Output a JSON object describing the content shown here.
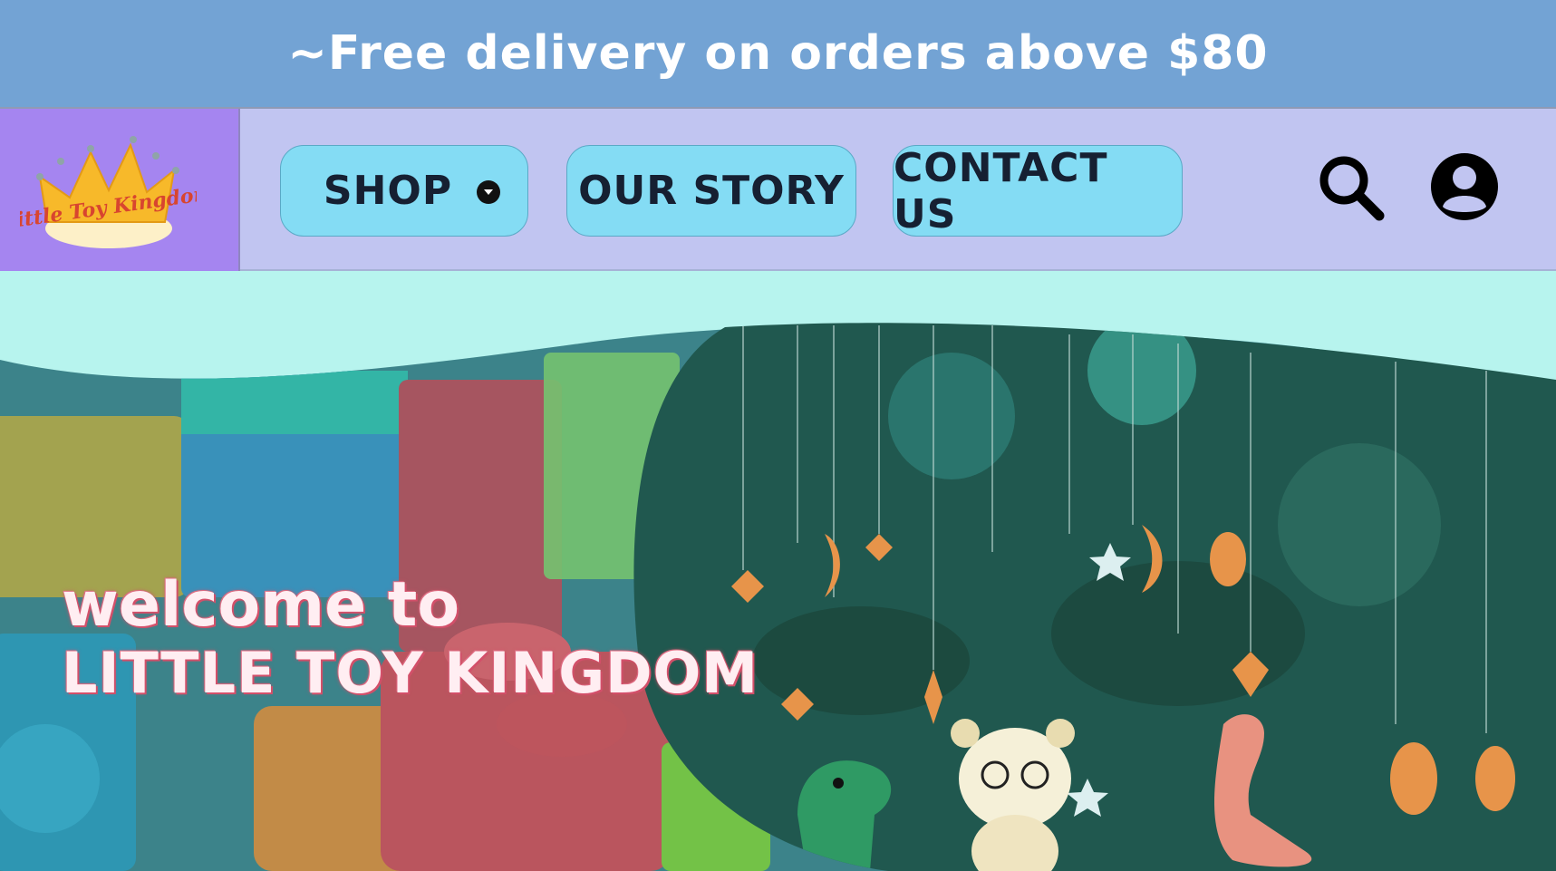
{
  "promo": {
    "text": "~Free delivery on orders above $80"
  },
  "brand": {
    "logo_text": "Little Toy Kingdom"
  },
  "nav": {
    "shop_label": "SHOP",
    "story_label": "OUR STORY",
    "contact_label": "CONTACT US"
  },
  "hero": {
    "welcome_line1": "welcome to",
    "welcome_line2": "LITTLE TOY KINGDOM"
  },
  "colors": {
    "promo_bg": "#73a3d4",
    "nav_bg": "#c1c5f1",
    "logo_bg": "#a585f0",
    "button_bg": "#84dcf4",
    "page_bg": "#b7f4ee",
    "welcome_text": "#ffeef2",
    "welcome_outline": "#d3506a"
  },
  "icons": [
    "chevron-down-icon",
    "search-icon",
    "account-icon",
    "crown-logo"
  ]
}
